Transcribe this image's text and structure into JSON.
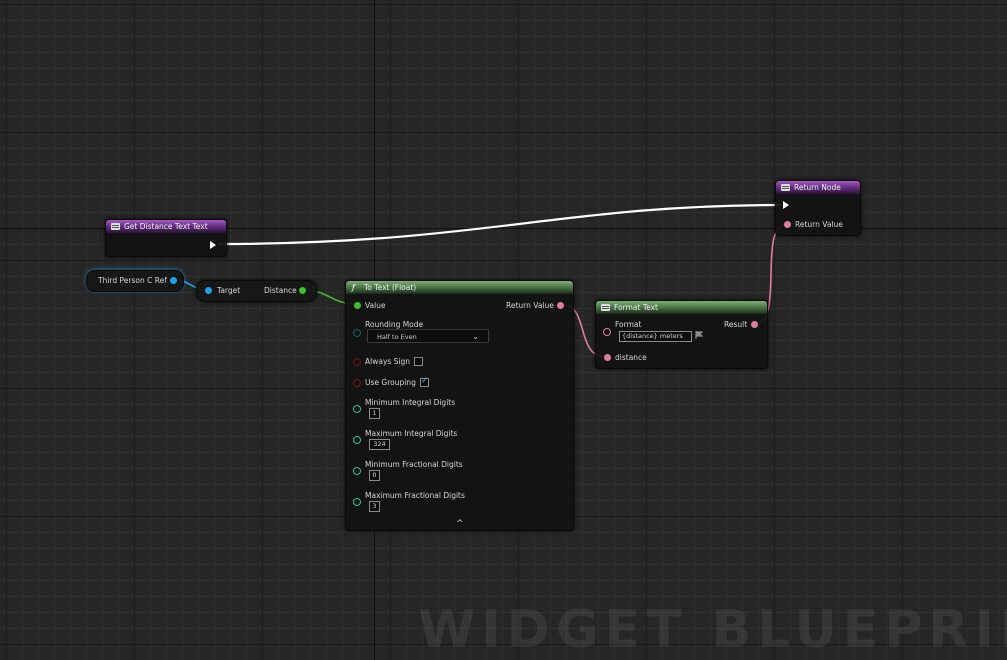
{
  "nodes": {
    "function_entry": {
      "title": "Get Distance Text Text"
    },
    "return_node": {
      "title": "Return Node",
      "return_value_label": "Return Value"
    },
    "variable": {
      "label": "Third Person C Ref"
    },
    "get_distance": {
      "target_label": "Target",
      "distance_label": "Distance"
    },
    "to_text": {
      "title": "To Text (Float)",
      "value_label": "Value",
      "return_value_label": "Return Value",
      "rounding_mode_label": "Rounding Mode",
      "rounding_mode_value": "Half to Even",
      "always_sign_label": "Always Sign",
      "always_sign_checked": false,
      "use_grouping_label": "Use Grouping",
      "use_grouping_checked": true,
      "min_integral_label": "Minimum Integral Digits",
      "min_integral_value": "1",
      "max_integral_label": "Maximum Integral Digits",
      "max_integral_value": "324",
      "min_fractional_label": "Minimum Fractional Digits",
      "min_fractional_value": "0",
      "max_fractional_label": "Maximum Fractional Digits",
      "max_fractional_value": "3",
      "collapse_arrow": "^"
    },
    "format_text": {
      "title": "Format Text",
      "format_label": "Format",
      "format_value": "{distance} meters",
      "result_label": "Result",
      "distance_label": "distance"
    }
  },
  "watermark": "WIDGET BLUEPRINT",
  "colors": {
    "exec_wire": "#ffffff",
    "object_wire": "#1fa3e8",
    "float_wire": "#3fbf2e",
    "text_wire": "#e07ea0",
    "function_header": "#7a3c96",
    "pure_function_header": "#5a8752"
  }
}
